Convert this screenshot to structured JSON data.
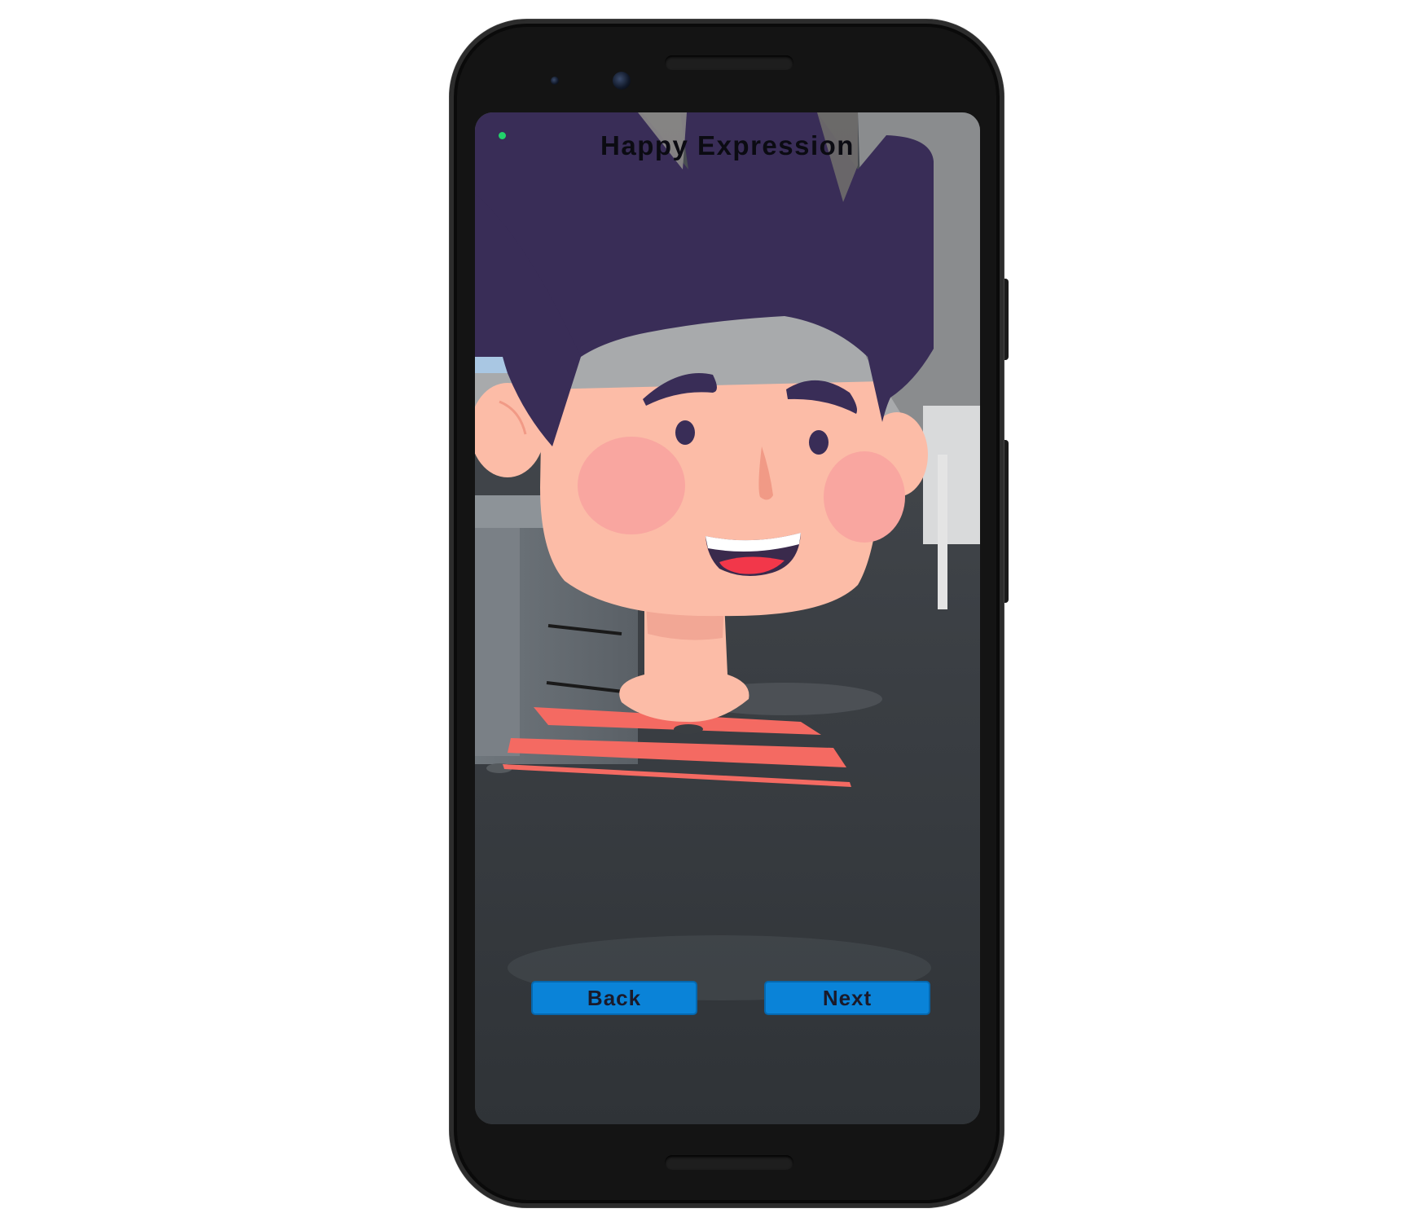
{
  "screen": {
    "title": "Happy Expression",
    "status_indicator_color": "#22d36b"
  },
  "character": {
    "expression": "happy",
    "hair_color": "#392d57",
    "skin_color": "#fcbca7",
    "cheek_color": "#f9a6a0",
    "shirt_stripe_color": "#f46a62"
  },
  "buttons": {
    "back_label": "Back",
    "next_label": "Next",
    "color": "#0a83d8"
  }
}
